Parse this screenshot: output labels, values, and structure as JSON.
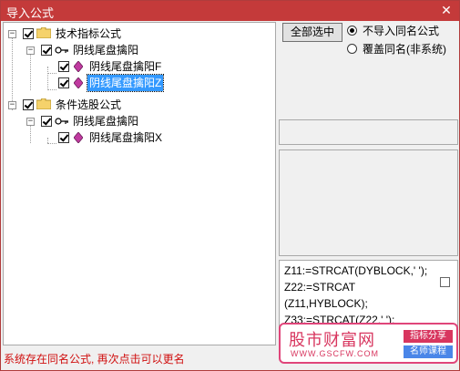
{
  "window": {
    "title": "导入公式",
    "close_glyph": "✕"
  },
  "tree": {
    "nodes": [
      {
        "label": "技术指标公式",
        "type": "folder",
        "expander": "−"
      },
      {
        "label": "阴线尾盘擒阳",
        "type": "group",
        "expander": "−"
      },
      {
        "label": "阴线尾盘擒阳F",
        "type": "formula"
      },
      {
        "label": "阴线尾盘擒阳Z",
        "type": "formula",
        "selected": true
      },
      {
        "label": "条件选股公式",
        "type": "folder",
        "expander": "−"
      },
      {
        "label": "阴线尾盘擒阳",
        "type": "group",
        "expander": "−"
      },
      {
        "label": "阴线尾盘擒阳X",
        "type": "formula"
      }
    ]
  },
  "actions": {
    "select_all_label": "全部选中"
  },
  "options": [
    {
      "label": "不导入同名公式",
      "selected": true
    },
    {
      "label": "覆盖同名(非系统)",
      "selected": false
    }
  ],
  "code": {
    "lines": [
      "Z11:=STRCAT(DYBLOCK,' ');",
      "Z22:=STRCAT",
      "(Z11,HYBLOCK);",
      "Z33:=STRCAT(Z22,' ');"
    ]
  },
  "watermark": {
    "title": "股市财富网",
    "url": "WWW.GSCFW.COM",
    "tag1": "指标分享",
    "tag2": "名师课程"
  },
  "status": {
    "text": "系统存在同名公式, 再次点击可以更名"
  },
  "colors": {
    "title_bar": "#c43a3a",
    "selection": "#3399ff",
    "status_text": "#d01010",
    "watermark": "#d8365f"
  }
}
